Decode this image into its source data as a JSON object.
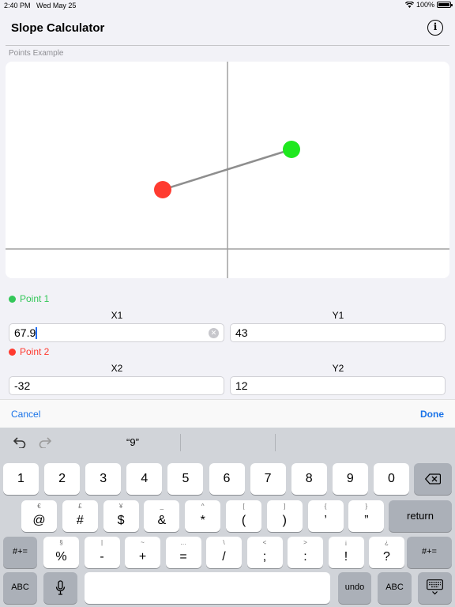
{
  "status": {
    "time": "2:40 PM",
    "date": "Wed May 25",
    "battery": "100%"
  },
  "nav": {
    "title": "Slope Calculator",
    "info_glyph": "i"
  },
  "section": {
    "label": "Points Example"
  },
  "point1": {
    "label": "Point 1",
    "color": "#34c759",
    "x_label": "X1",
    "y_label": "Y1",
    "x_value": "67.9",
    "y_value": "43"
  },
  "point2": {
    "label": "Point 2",
    "color": "#ff3b30",
    "x_label": "X2",
    "y_label": "Y2",
    "x_value": "-32",
    "y_value": "12"
  },
  "toolbar": {
    "cancel": "Cancel",
    "done": "Done"
  },
  "keyboard": {
    "suggestion": "“9”",
    "row1": [
      "1",
      "2",
      "3",
      "4",
      "5",
      "6",
      "7",
      "8",
      "9",
      "0"
    ],
    "row2": [
      {
        "main": "@",
        "sub": "€"
      },
      {
        "main": "#",
        "sub": "£"
      },
      {
        "main": "$",
        "sub": "¥"
      },
      {
        "main": "&",
        "sub": "_"
      },
      {
        "main": "*",
        "sub": "^"
      },
      {
        "main": "(",
        "sub": "["
      },
      {
        "main": ")",
        "sub": "]"
      },
      {
        "main": "’",
        "sub": "{"
      },
      {
        "main": "”",
        "sub": "}"
      }
    ],
    "return": "return",
    "row3": [
      {
        "main": "%",
        "sub": "§"
      },
      {
        "main": "-",
        "sub": "|"
      },
      {
        "main": "+",
        "sub": "~"
      },
      {
        "main": "=",
        "sub": "…"
      },
      {
        "main": "/",
        "sub": "\\"
      },
      {
        "main": ";",
        "sub": "<"
      },
      {
        "main": ":",
        "sub": ">"
      },
      {
        "main": "!",
        "sub": "¡"
      },
      {
        "main": "?",
        "sub": "¿"
      }
    ],
    "shift": "#+=",
    "abc": "ABC",
    "undo": "undo"
  }
}
